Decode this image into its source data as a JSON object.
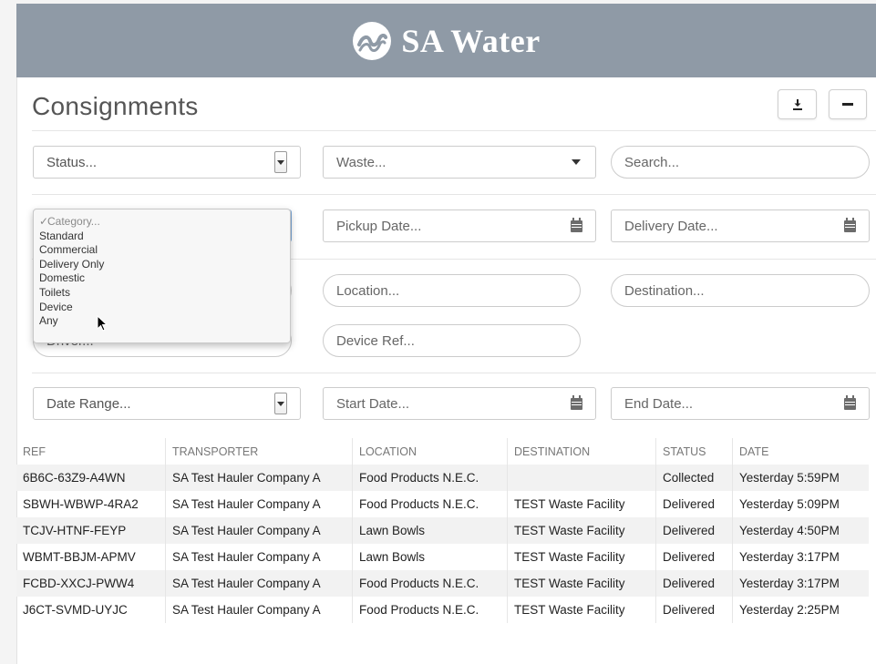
{
  "header": {
    "brand": "SA Water",
    "logo_icon": "sa-water-logo"
  },
  "page": {
    "title": "Consignments"
  },
  "toolbar": {
    "download_icon": "download-icon",
    "collapse_icon": "minus-icon"
  },
  "filters": {
    "status_placeholder": "Status...",
    "waste_placeholder": "Waste...",
    "search_placeholder": "Search...",
    "pickup_placeholder": "Pickup Date...",
    "delivery_placeholder": "Delivery Date...",
    "location_placeholder": "Location...",
    "destination_placeholder": "Destination...",
    "driver_placeholder": "Driver...",
    "device_ref_placeholder": "Device Ref...",
    "date_range_placeholder": "Date Range...",
    "start_date_placeholder": "Start Date...",
    "end_date_placeholder": "End Date..."
  },
  "category_dropdown": {
    "selected_mark": "✓",
    "options": [
      "Category...",
      "Standard",
      "Commercial",
      "Delivery Only",
      "Domestic",
      "Toilets",
      "Device",
      "Any"
    ]
  },
  "table": {
    "columns": [
      "REF",
      "TRANSPORTER",
      "LOCATION",
      "DESTINATION",
      "STATUS",
      "DATE"
    ],
    "rows": [
      [
        "6B6C-63Z9-A4WN",
        "SA Test Hauler Company A",
        "Food Products N.E.C.",
        "",
        "Collected",
        "Yesterday 5:59PM"
      ],
      [
        "SBWH-WBWP-4RA2",
        "SA Test Hauler Company A",
        "Food Products N.E.C.",
        "TEST Waste Facility",
        "Delivered",
        "Yesterday 5:09PM"
      ],
      [
        "TCJV-HTNF-FEYP",
        "SA Test Hauler Company A",
        "Lawn Bowls",
        "TEST Waste Facility",
        "Delivered",
        "Yesterday 4:50PM"
      ],
      [
        "WBMT-BBJM-APMV",
        "SA Test Hauler Company A",
        "Lawn Bowls",
        "TEST Waste Facility",
        "Delivered",
        "Yesterday 3:17PM"
      ],
      [
        "FCBD-XXCJ-PWW4",
        "SA Test Hauler Company A",
        "Food Products N.E.C.",
        "TEST Waste Facility",
        "Delivered",
        "Yesterday 3:17PM"
      ],
      [
        "J6CT-SVMD-UYJC",
        "SA Test Hauler Company A",
        "Food Products N.E.C.",
        "TEST Waste Facility",
        "Delivered",
        "Yesterday 2:25PM"
      ]
    ]
  },
  "colors": {
    "header_bg": "#8f9aa6",
    "stripe": "#f2f2f2",
    "border": "#cccccc"
  }
}
